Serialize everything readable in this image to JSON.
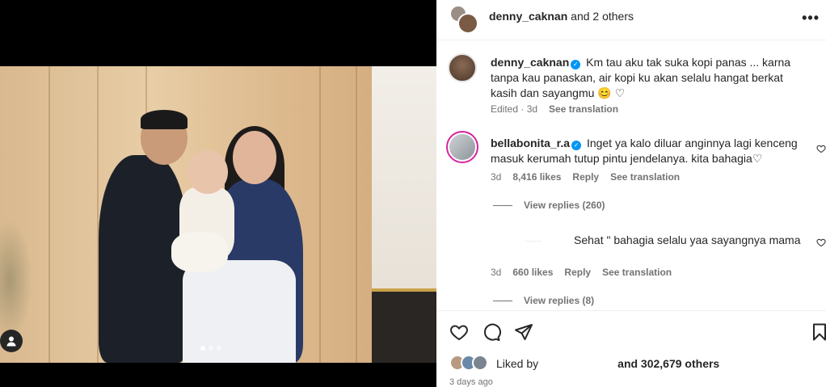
{
  "post": {
    "slide_count": 3,
    "active_slide": 1
  },
  "header": {
    "username": "denny_caknan",
    "coauthors": "and 2 others",
    "more": "•••"
  },
  "caption": {
    "username": "denny_caknan",
    "text": "Km tau aku tak suka kopi panas ... karna tanpa kau panaskan, air kopi ku akan selalu hangat berkat kasih dan sayangmu 😊 ♡",
    "edited": "Edited · 3d",
    "see_translation": "See translation"
  },
  "comments": [
    {
      "username": "bellabonita_r.a",
      "text": "Inget ya kalo diluar anginnya lagi kenceng masuk kerumah tutup pintu jendelanya. kita bahagia♡",
      "age": "3d",
      "likes": "8,416 likes",
      "reply": "Reply",
      "see_translation": "See translation",
      "view_replies": "View replies (260)"
    },
    {
      "username": "",
      "text": "Sehat \" bahagia selalu yaa sayangnya mama",
      "age": "3d",
      "likes": "660 likes",
      "reply": "Reply",
      "see_translation": "See translation",
      "view_replies": "View replies (8)"
    }
  ],
  "likes": {
    "prefix": "Liked by",
    "suffix": "and 302,679 others"
  },
  "posted": "3 days ago",
  "colors": {
    "verified": "#0095f6",
    "text": "#262626",
    "secondary": "#737373",
    "story_ring": "#d6249f"
  }
}
